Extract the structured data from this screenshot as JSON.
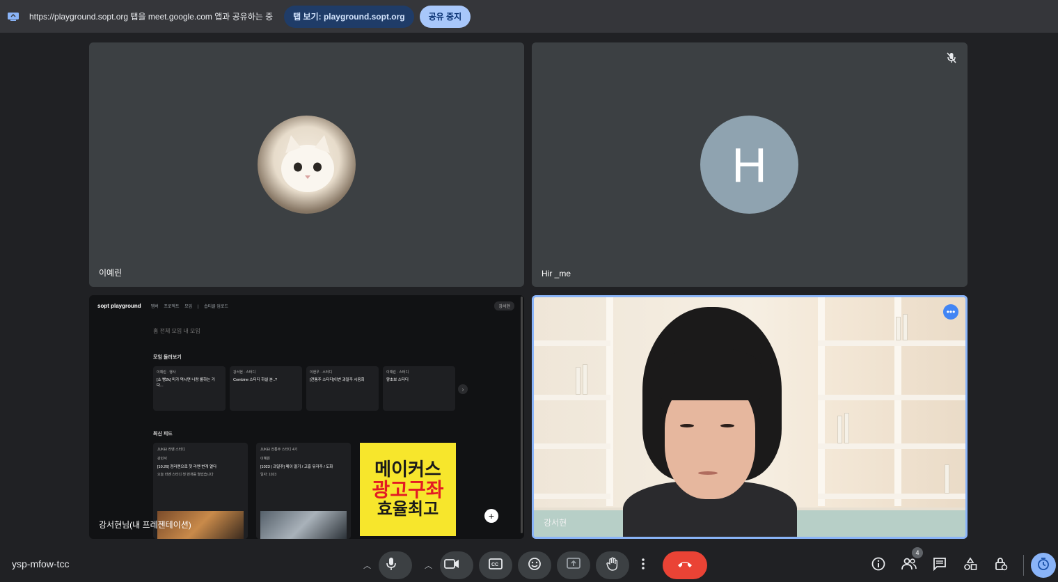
{
  "share_bar": {
    "text": "https://playground.sopt.org 탭을 meet.google.com 앱과 공유하는 중",
    "view_tab_label": "탭 보기: playground.sopt.org",
    "stop_share_label": "공유 중지"
  },
  "tiles": [
    {
      "name": "이예린",
      "avatar": "cat-photo"
    },
    {
      "name": "Hir _me",
      "avatar_letter": "H",
      "avatar_color": "#8fa3b0",
      "muted": true
    },
    {
      "name": "강서현님(내 프레젠테이션)",
      "type": "screen-share"
    },
    {
      "name": "강서현",
      "type": "camera",
      "active_speaker": true
    }
  ],
  "screen_share": {
    "logo": "sopt playground",
    "nav": [
      "멤버",
      "프로젝트",
      "모임",
      "|",
      "솝티클 업로드"
    ],
    "user": "강서현",
    "tabs": "홈  전체 모임  내 모임",
    "section1": "모임 둘러보기",
    "cards": [
      {
        "meta": "이예린 · 행사",
        "title": "[소 빵2k] 미가 먹시면 나랑 롤하는 거 다..."
      },
      {
        "meta": "강서현 · 스터디",
        "title": "Combine 스터디 하실 분..?"
      },
      {
        "meta": "이현우 · 스터디",
        "title": "[전통주 스터디]이번 과일주 시음회"
      },
      {
        "meta": "이예린 · 스터디",
        "title": "왕초보 스터디"
      }
    ],
    "section2": "최신 피드",
    "feeds": [
      {
        "group": "JUKEI 라멘 스터디",
        "user": "강민서",
        "title": "[10.26] 정라멘으로 첫 라멘 번개 열다",
        "sub": "오늘 라멘 스터디 첫 번개를 열었습니다"
      },
      {
        "group": "JUKEI 전통주 스터디 4기",
        "user": "이혜원",
        "title": "[1023 | 과일주] 메이 딸기 / 고흥 유자주 / 도화",
        "sub": "일자: 1023"
      }
    ],
    "ad": [
      "메이커스",
      "광고구좌",
      "효율최고"
    ]
  },
  "bottom_bar": {
    "meeting_code": "ysp-mfow-tcc",
    "participant_count": "4",
    "colors": {
      "end_call": "#ea4335",
      "accent": "#8ab4f8"
    }
  },
  "icons": [
    "screen-share-icon",
    "mic-icon",
    "camera-icon",
    "captions-icon",
    "emoji-icon",
    "present-icon",
    "raise-hand-icon",
    "more-options-icon",
    "end-call-icon",
    "info-icon",
    "people-icon",
    "chat-icon",
    "activities-icon",
    "host-controls-icon",
    "timer-icon",
    "mic-off-icon",
    "more-dots-icon"
  ]
}
